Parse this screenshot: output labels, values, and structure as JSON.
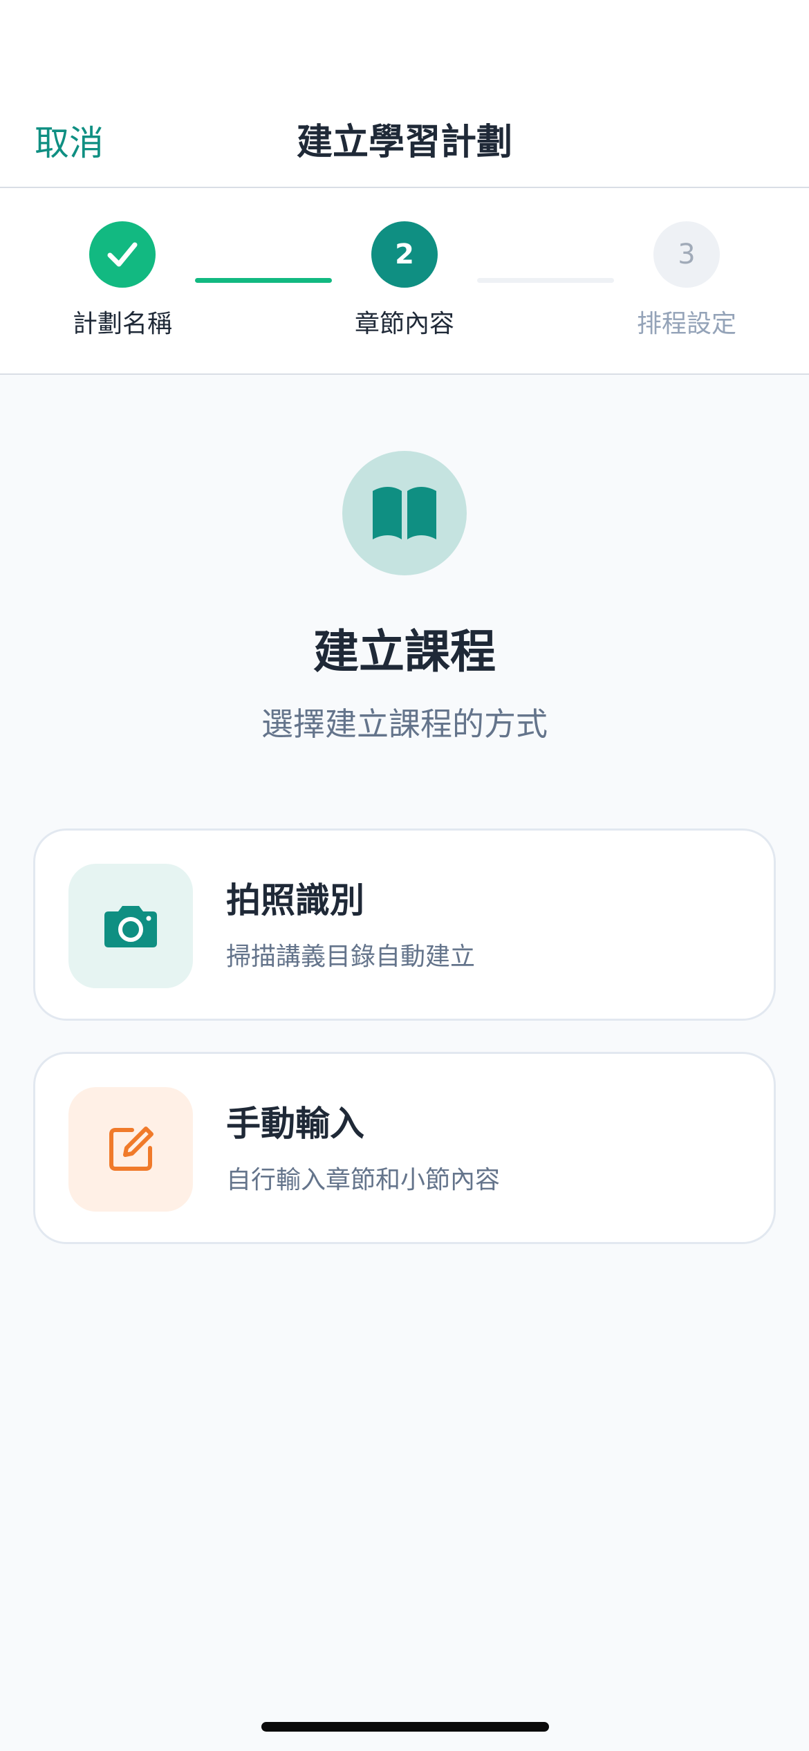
{
  "header": {
    "cancel_label": "取消",
    "title": "建立學習計劃"
  },
  "stepper": {
    "steps": [
      {
        "label": "計劃名稱",
        "number": "",
        "status": "completed"
      },
      {
        "label": "章節內容",
        "number": "2",
        "status": "active"
      },
      {
        "label": "排程設定",
        "number": "3",
        "status": "pending"
      }
    ]
  },
  "hero": {
    "icon": "open-book-icon",
    "title": "建立課程",
    "subtitle": "選擇建立課程的方式"
  },
  "options": [
    {
      "icon": "camera-icon",
      "title": "拍照識別",
      "description": "掃描講義目錄自動建立",
      "accent": "#0f8f82"
    },
    {
      "icon": "edit-icon",
      "title": "手動輸入",
      "description": "自行輸入章節和小節內容",
      "accent": "#f07a2a"
    }
  ],
  "colors": {
    "primary": "#0f8f82",
    "success": "#12b981",
    "orange": "#f07a2a"
  }
}
